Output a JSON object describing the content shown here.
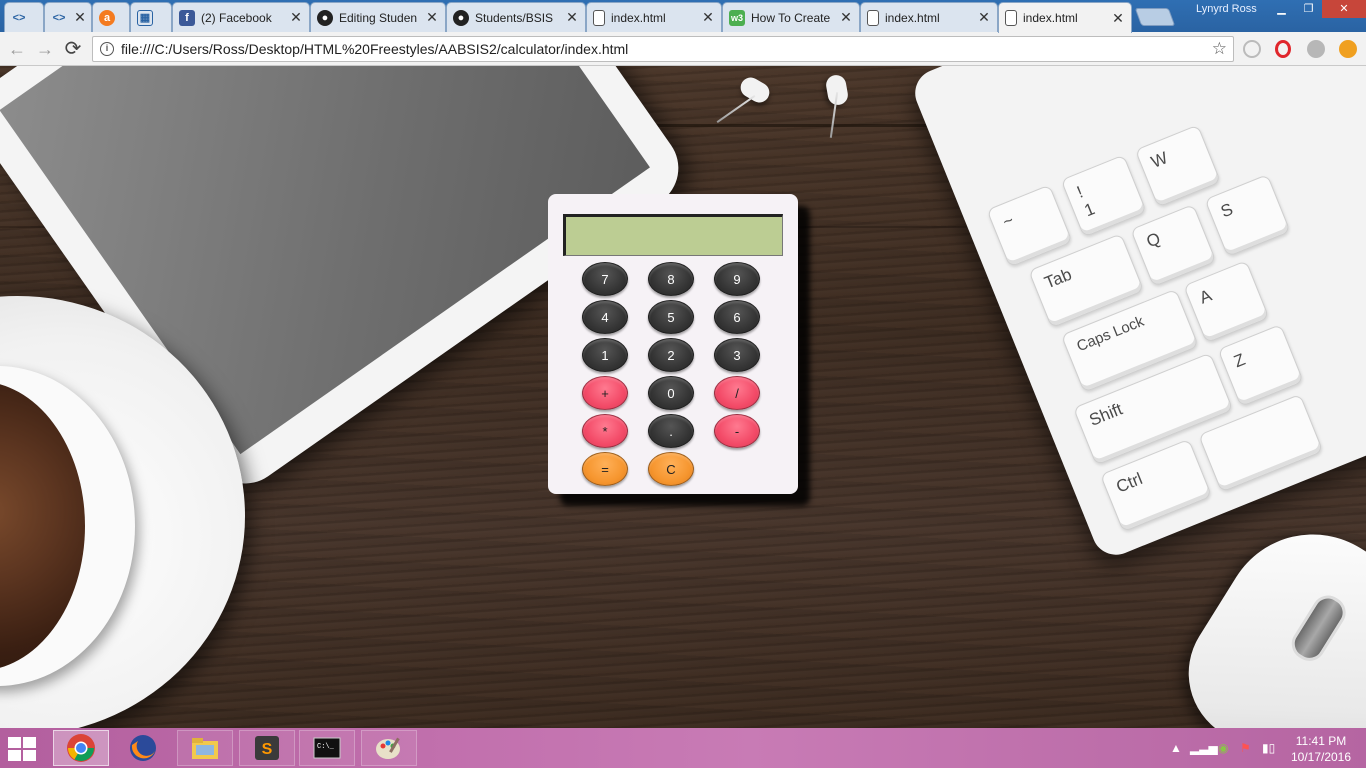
{
  "browser": {
    "tabs": [
      {
        "title": "",
        "icon": "code-icon"
      },
      {
        "title": "",
        "icon": "code-icon"
      },
      {
        "title": "",
        "icon": "avast-icon"
      },
      {
        "title": "",
        "icon": "grid-icon"
      },
      {
        "title": "(2) Facebook",
        "icon": "facebook-icon"
      },
      {
        "title": "Editing Studen",
        "icon": "github-icon"
      },
      {
        "title": "Students/BSIS",
        "icon": "github-icon"
      },
      {
        "title": "index.html",
        "icon": "file-icon"
      },
      {
        "title": "How To Create",
        "icon": "w3-icon"
      },
      {
        "title": "index.html",
        "icon": "file-icon"
      },
      {
        "title": "index.html",
        "icon": "file-icon",
        "active": true
      }
    ],
    "profile_name": "Lynyrd Ross",
    "url": "file:///C:/Users/Ross/Desktop/HTML%20Freestyles/AABSIS2/calculator/index.html",
    "nav": {
      "back": "←",
      "forward": "→",
      "reload": "⟳"
    }
  },
  "calculator": {
    "display_value": "",
    "buttons": [
      [
        "7",
        "8",
        "9"
      ],
      [
        "4",
        "5",
        "6"
      ],
      [
        "1",
        "2",
        "3"
      ],
      [
        "+",
        "0",
        "/"
      ],
      [
        "*",
        ".",
        "-"
      ],
      [
        "=",
        "C"
      ]
    ]
  },
  "desk": {
    "keyboard_keys": [
      "~",
      "!",
      "1",
      "W",
      "Q",
      "Tab",
      "S",
      "A",
      "Caps Lock",
      "Z",
      "Shift",
      "Ctrl"
    ]
  },
  "taskbar": {
    "apps": [
      "chrome-icon",
      "firefox-icon",
      "file-explorer-icon",
      "sublime-text-icon",
      "command-prompt-icon",
      "paint-icon"
    ],
    "time": "11:41 PM",
    "date": "10/17/2016"
  }
}
